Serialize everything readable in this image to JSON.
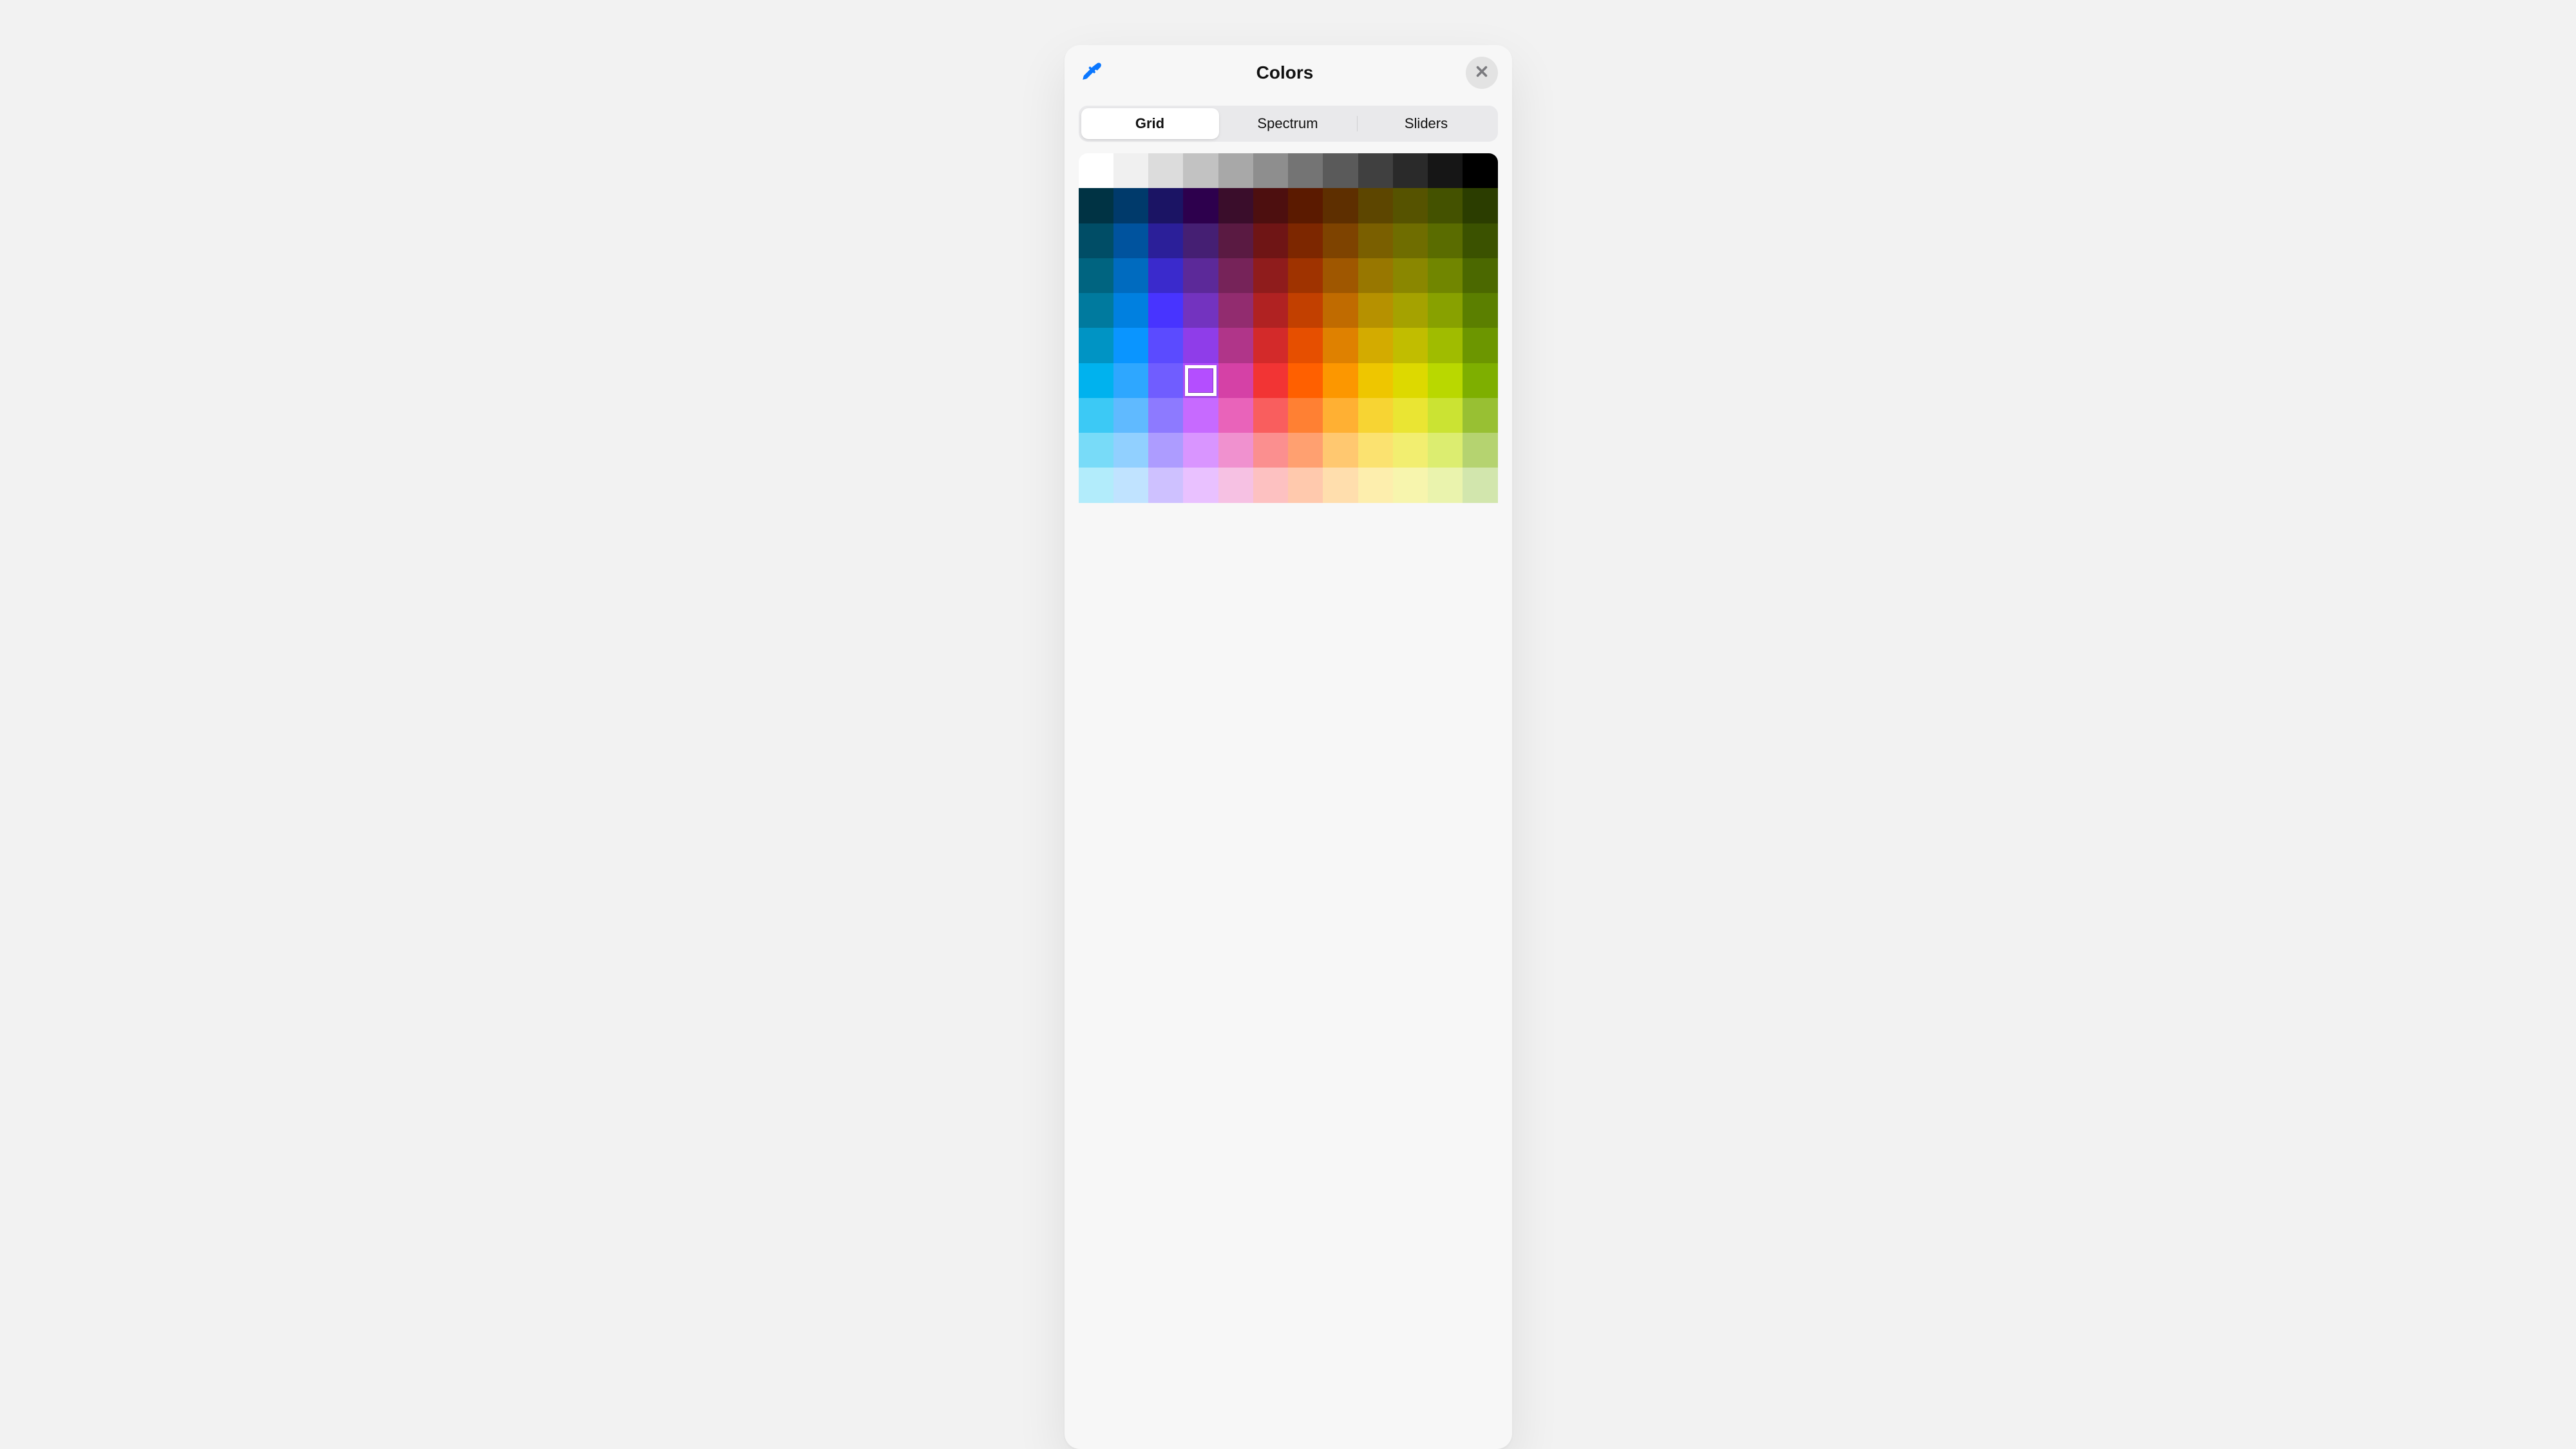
{
  "header": {
    "title": "Colors",
    "eyedropper_icon": "eyedropper",
    "close_icon": "close"
  },
  "tabs": [
    {
      "label": "Grid",
      "active": true
    },
    {
      "label": "Spectrum",
      "active": false
    },
    {
      "label": "Sliders",
      "active": false
    }
  ],
  "selected_index": 75,
  "grid_colors": [
    "#ffffff",
    "#f0f0f0",
    "#dcdcdc",
    "#c2c2c2",
    "#a8a8a8",
    "#8e8e8e",
    "#747474",
    "#5a5a5a",
    "#404040",
    "#2a2a2a",
    "#161616",
    "#000000",
    "#003344",
    "#003a6b",
    "#1b1464",
    "#2d004d",
    "#3a0d2b",
    "#4d0f0f",
    "#5b1a00",
    "#5e2f00",
    "#5d4600",
    "#565300",
    "#445200",
    "#2b3d00",
    "#004d66",
    "#00539e",
    "#2b1f99",
    "#451f73",
    "#5a1a42",
    "#6f1515",
    "#7d2700",
    "#7e4300",
    "#7a5f00",
    "#6f6d00",
    "#5a6c00",
    "#3b5200",
    "#006480",
    "#006bbf",
    "#3a2acc",
    "#5c2999",
    "#762359",
    "#8f1c1c",
    "#9f3300",
    "#9f5700",
    "#987700",
    "#8a8700",
    "#718600",
    "#4b6800",
    "#007a9e",
    "#0080e0",
    "#4834ff",
    "#7333bf",
    "#922c6f",
    "#b02222",
    "#c24000",
    "#c06b00",
    "#b69100",
    "#a5a200",
    "#88a100",
    "#5b7f00",
    "#0094c4",
    "#0a95ff",
    "#5b4bff",
    "#8f3de9",
    "#b03589",
    "#d32a2a",
    "#e64f00",
    "#df8100",
    "#d3ab00",
    "#c1bd00",
    "#a0bc00",
    "#6c9600",
    "#00b2ee",
    "#2ea7ff",
    "#705dff",
    "#b44eff",
    "#d541a6",
    "#f23434",
    "#ff6000",
    "#fc9700",
    "#eec600",
    "#ddd900",
    "#b9d800",
    "#7eaf00",
    "#3cc9f5",
    "#60baff",
    "#8d7aff",
    "#c76aff",
    "#e963ba",
    "#f95e5e",
    "#ff8033",
    "#ffb033",
    "#f7d433",
    "#eae533",
    "#cbe333",
    "#98c033",
    "#78dbf8",
    "#91d0ff",
    "#ad9cff",
    "#d995ff",
    "#f091cf",
    "#fb8f8f",
    "#ffa070",
    "#ffc870",
    "#fbe270",
    "#f2ee70",
    "#dced70",
    "#b5d370",
    "#b2ecfb",
    "#c0e3ff",
    "#cec1ff",
    "#e9c1ff",
    "#f6c1e3",
    "#fdc1c1",
    "#ffc9ad",
    "#ffdead",
    "#fdeead",
    "#f7f5ad",
    "#eaf3ad",
    "#d2e6ad"
  ]
}
